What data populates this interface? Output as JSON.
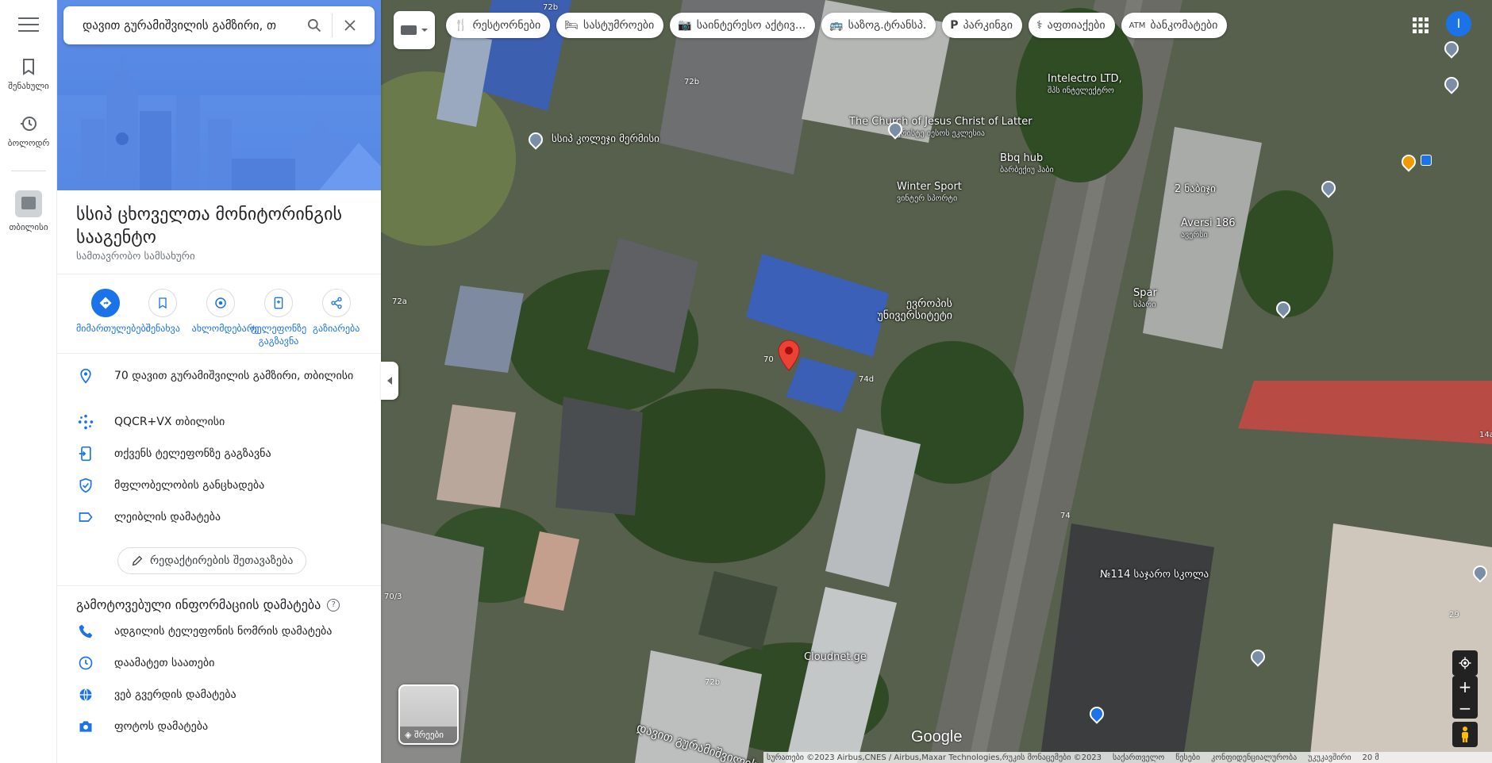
{
  "search": {
    "value": "დავით გურამიშვილის გამზირი, თ"
  },
  "rail": {
    "saved": "შენახული",
    "recents": "ბოლოდრ",
    "tbilisi": "თბილისი"
  },
  "place": {
    "name": "სსიპ ცხოველთა მონიტორინგის სააგენტო",
    "category": "სამთავრობო სამსახური"
  },
  "actions": [
    {
      "label": "მიმართულებები"
    },
    {
      "label": "შენახვა"
    },
    {
      "label": "ახლომდებარე"
    },
    {
      "label": "ტელეფონზე გაგზავნა"
    },
    {
      "label": "გაზიარება"
    }
  ],
  "info": {
    "address": "70 დავით გურამიშვილის გამზირი, თბილისი",
    "plus_code": "QQCR+VX თბილისი",
    "send_to_phone": "თქვენს ტელეფონზე გაგზავნა",
    "claim": "მფლობელობის განცხადება",
    "label": "ლეიბლის დამატება",
    "suggest_edit": "რედაქტირების შეთავაზება"
  },
  "missing": {
    "title": "გამოტოვებული ინფორმაციის დამატება",
    "phone": "ადგილის ტელეფონის ნომრის დამატება",
    "hours": "დაამატეთ საათები",
    "website": "ვებ გვერდის დამატება",
    "photo": "ფოტოს დამატება"
  },
  "chips": [
    {
      "icon": "restaurant-icon",
      "label": "რესტორნები"
    },
    {
      "icon": "hotel-icon",
      "label": "სასტუმროები"
    },
    {
      "icon": "camera-icon",
      "label": "საინტერესო აქტივ..."
    },
    {
      "icon": "bus-icon",
      "label": "საზოგ.ტრანსპ."
    },
    {
      "icon": "parking-icon",
      "label": "პარკინგი"
    },
    {
      "icon": "pharmacy-icon",
      "label": "აფთიაქები"
    },
    {
      "icon": "atm-icon",
      "label": "ბანკომატები"
    }
  ],
  "avatar": "I",
  "map_labels": {
    "college": "სსიპ კოლეჯი მერმისი",
    "church": "The Church of Jesus Christ of Latter",
    "church_sub": "ქრისტე იესოს ეკლესია",
    "intelectro": "Intelectro LTD,",
    "intelectro_sub": "შპს ინტელექტრო",
    "bbq": "Bbq hub",
    "bbq_sub": "ბარბექიუ ჰაბი",
    "winter": "Winter Sport",
    "winter_sub": "ვინტერ სპორტი",
    "european_uni": "ევროპის უნივერსიტეტი",
    "two_nabiji": "2 ნაბიჯი",
    "aversi": "Aversi 186",
    "aversi_sub": "ავერსი",
    "spar": "Spar",
    "spar_sub": "სპარი",
    "school": "№114 საჯარო სკოლა",
    "cloudnet": "Cloudnet.ge",
    "street": "დავით გურამიშვილის",
    "n72b": "72b",
    "n72a": "72a",
    "n70": "70",
    "n74d": "74d",
    "n74": "74",
    "n703": "70/3",
    "n14a": "14a",
    "n29": "29"
  },
  "layers_label": "შრეები",
  "google": "Google",
  "footer": {
    "attribution": "სურათები ©2023 Airbus,CNES / Airbus,Maxar Technologies,რუკის მონაცემები ©2023",
    "privacy": "საქართველო",
    "terms": "წესები",
    "privacy2": "კონფიდენციალურობა",
    "feedback": "უკუკავშირი",
    "scale": "20 მ"
  }
}
